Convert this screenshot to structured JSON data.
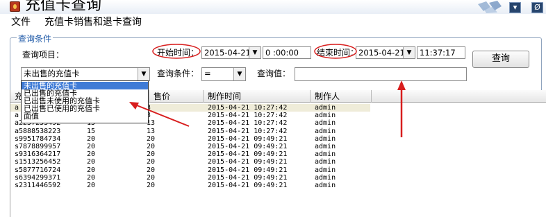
{
  "window": {
    "title": "充值卡查询",
    "minimize_label": "▾",
    "close_label": "Ø"
  },
  "menu": {
    "items": [
      "文件",
      "充值卡销售和退卡查询"
    ]
  },
  "query": {
    "group_title": "查询条件",
    "item_label": "查询项目：",
    "start_label": "开始时间：",
    "start_date": "2015-04-21",
    "start_time": "0 :00:00",
    "end_label": "结束时间：",
    "end_date": "2015-04-21",
    "end_time": "11:37:17",
    "item_value": "未出售的充值卡",
    "condition_label": "查询条件：",
    "condition_value": "=",
    "value_label": "查询值：",
    "value_input": "",
    "search_button": "查询"
  },
  "dropdown": {
    "options": [
      "未出售的充值卡",
      "已出售的充值卡",
      "已出售未使用的充值卡",
      "已出售已使用的充值卡",
      "面值"
    ],
    "selected_index": 0
  },
  "table": {
    "columns": [
      "充",
      "售价",
      "制作时间",
      "制作人"
    ],
    "rows": [
      [
        "a",
        "",
        "3",
        "2015-04-21 10:27:42",
        "admin"
      ],
      [
        "a",
        "",
        "3",
        "2015-04-21 10:27:42",
        "admin"
      ],
      [
        "a2257253492",
        "15",
        "13",
        "2015-04-21 10:27:42",
        "admin"
      ],
      [
        "a5888538223",
        "15",
        "13",
        "2015-04-21 10:27:42",
        "admin"
      ],
      [
        "s9951784734",
        "20",
        "20",
        "2015-04-21 09:49:21",
        "admin"
      ],
      [
        "s7878899957",
        "20",
        "20",
        "2015-04-21 09:49:21",
        "admin"
      ],
      [
        "s9316364217",
        "20",
        "20",
        "2015-04-21 09:49:21",
        "admin"
      ],
      [
        "s1513256452",
        "20",
        "20",
        "2015-04-21 09:49:21",
        "admin"
      ],
      [
        "s5877716724",
        "20",
        "20",
        "2015-04-21 09:49:21",
        "admin"
      ],
      [
        "s6394299371",
        "20",
        "20",
        "2015-04-21 09:49:21",
        "admin"
      ],
      [
        "s2311446592",
        "20",
        "20",
        "2015-04-21 09:49:21",
        "admin"
      ]
    ]
  },
  "colors": {
    "annotation_red": "#d81e1e",
    "selection_blue": "#3f7bd6",
    "highlight_row": "#efecd9",
    "group_title": "#1f5aa8"
  }
}
